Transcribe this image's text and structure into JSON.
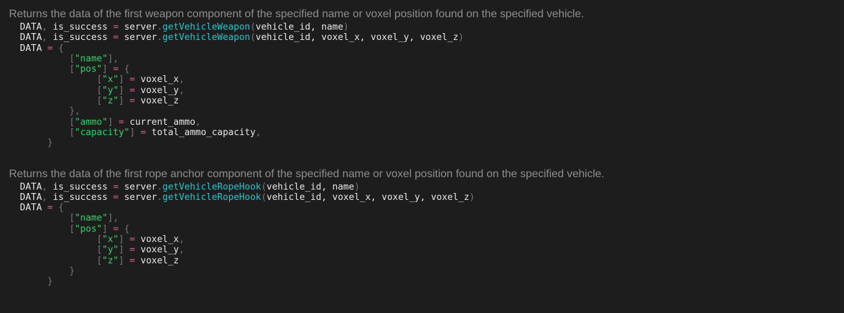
{
  "sections": [
    {
      "description": "Returns the data of the first weapon component of the specified name or voxel position found on the specified vehicle.",
      "function_name": "getVehicleWeapon",
      "call_line_1_args": "vehicle_id, name",
      "call_line_2_args": "vehicle_id, voxel_x, voxel_y, voxel_z",
      "fields": {
        "name_key": "\"name\"",
        "pos_key": "\"pos\"",
        "x_key": "\"x\"",
        "y_key": "\"y\"",
        "z_key": "\"z\"",
        "x_val": "voxel_x",
        "y_val": "voxel_y",
        "z_val": "voxel_z",
        "ammo_key": "\"ammo\"",
        "ammo_val": "current_ammo",
        "capacity_key": "\"capacity\"",
        "capacity_val": "total_ammo_capacity"
      }
    },
    {
      "description": "Returns the data of the first rope anchor component of the specified name or voxel position found on the specified vehicle.",
      "function_name": "getVehicleRopeHook",
      "call_line_1_args": "vehicle_id, name",
      "call_line_2_args": "vehicle_id, voxel_x, voxel_y, voxel_z",
      "fields": {
        "name_key": "\"name\"",
        "pos_key": "\"pos\"",
        "x_key": "\"x\"",
        "y_key": "\"y\"",
        "z_key": "\"z\"",
        "x_val": "voxel_x",
        "y_val": "voxel_y",
        "z_val": "voxel_z"
      }
    }
  ],
  "common": {
    "data_var": "DATA",
    "success_var": "is_success",
    "object": "server"
  }
}
